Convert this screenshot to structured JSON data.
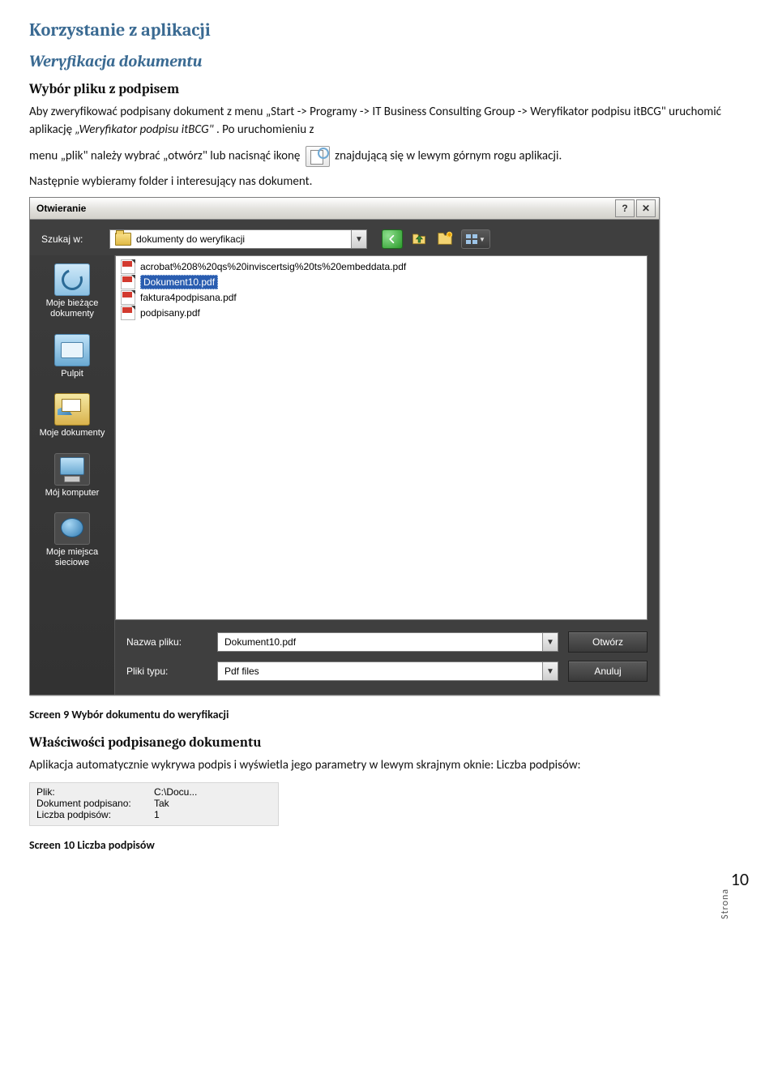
{
  "headings": {
    "h1": "Korzystanie z aplikacji",
    "h2a": "Weryfikacja dokumentu",
    "h3a": "Wybór pliku z podpisem",
    "h3b": "Właściwości podpisanego dokumentu"
  },
  "para": {
    "p1a": "Aby zweryfikować podpisany dokument z menu „Start -> Programy -> IT Business Consulting Group -> Weryfikator podpisu itBCG\" uruchomić aplikację ",
    "p1b": "„Weryfikator podpisu itBCG\"",
    "p1c": ". Po uruchomieniu z",
    "p2a": "menu „plik\" należy wybrać „otwórz\" lub nacisnąć ikonę ",
    "p2b": " znajdującą się w lewym górnym rogu aplikacji.",
    "p3": "Następnie wybieramy folder i interesujący nas dokument.",
    "p4": "Aplikacja automatycznie wykrywa podpis i wyświetla jego parametry w lewym skrajnym oknie: Liczba podpisów:"
  },
  "captions": {
    "c1": "Screen 9 Wybór dokumentu do weryfikacji",
    "c2": "Screen 10 Liczba podpisów"
  },
  "dialog": {
    "title": "Otwieranie",
    "lookin_label": "Szukaj w:",
    "folder": "dokumenty do weryfikacji",
    "files": [
      "acrobat%208%20qs%20inviscertsig%20ts%20embeddata.pdf",
      "Dokument10.pdf",
      "faktura4podpisana.pdf",
      "podpisany.pdf"
    ],
    "selected_index": 1,
    "places": {
      "recent": "Moje bieżące dokumenty",
      "desktop": "Pulpit",
      "mydocs": "Moje dokumenty",
      "computer": "Mój komputer",
      "network": "Moje miejsca sieciowe"
    },
    "filename_label": "Nazwa pliku:",
    "filename_value": "Dokument10.pdf",
    "filetype_label": "Pliki typu:",
    "filetype_value": "Pdf files",
    "open_btn": "Otwórz",
    "cancel_btn": "Anuluj",
    "help_glyph": "?",
    "close_glyph": "✕"
  },
  "props": {
    "file_label": "Plik:",
    "file_value": "C:\\Docu...",
    "signed_label": "Dokument podpisano:",
    "signed_value": "Tak",
    "count_label": "Liczba podpisów:",
    "count_value": "1"
  },
  "page": {
    "side": "Strona",
    "num": "10"
  }
}
